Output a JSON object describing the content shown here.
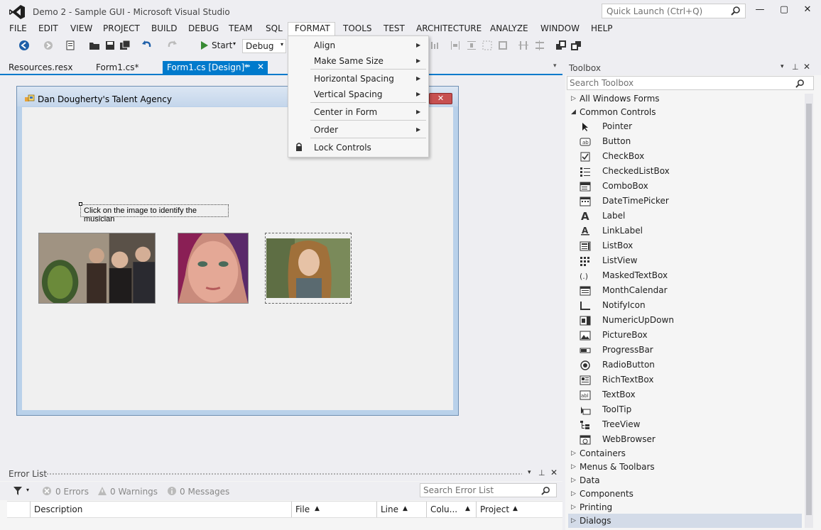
{
  "window": {
    "title": "Demo 2 - Sample GUI - Microsoft Visual Studio",
    "quick_launch_placeholder": "Quick Launch (Ctrl+Q)",
    "minimize": "—",
    "maximize": "▢",
    "close": "✕"
  },
  "menu": [
    "FILE",
    "EDIT",
    "VIEW",
    "PROJECT",
    "BUILD",
    "DEBUG",
    "TEAM",
    "SQL",
    "FORMAT",
    "TOOLS",
    "TEST",
    "ARCHITECTURE",
    "ANALYZE",
    "WINDOW",
    "HELP"
  ],
  "toolbar": {
    "start_label": "Start",
    "config_value": "Debug"
  },
  "tabs": {
    "resources": "Resources.resx",
    "form_cs": "Form1.cs*",
    "form_design": "Form1.cs [Design]*"
  },
  "format_menu": {
    "align": "Align",
    "make_same_size": "Make Same Size",
    "horizontal_spacing": "Horizontal Spacing",
    "vertical_spacing": "Vertical Spacing",
    "center_in_form": "Center in Form",
    "order": "Order",
    "lock_controls": "Lock Controls"
  },
  "form": {
    "title": "Dan Dougherty's Talent Agency",
    "close": "✕",
    "label_text": "Click on the image to identify the musician"
  },
  "error_list": {
    "title": "Error List",
    "errors": "0 Errors",
    "warnings": "0 Warnings",
    "messages": "0 Messages",
    "search_placeholder": "Search Error List",
    "columns": {
      "description": "Description",
      "file": "File",
      "line": "Line",
      "column": "Colu...",
      "project": "Project"
    }
  },
  "toolbox": {
    "title": "Toolbox",
    "search_placeholder": "Search Toolbox",
    "all_windows_forms": "All Windows Forms",
    "common_controls": "Common Controls",
    "items": [
      "Pointer",
      "Button",
      "CheckBox",
      "CheckedListBox",
      "ComboBox",
      "DateTimePicker",
      "Label",
      "LinkLabel",
      "ListBox",
      "ListView",
      "MaskedTextBox",
      "MonthCalendar",
      "NotifyIcon",
      "NumericUpDown",
      "PictureBox",
      "ProgressBar",
      "RadioButton",
      "RichTextBox",
      "TextBox",
      "ToolTip",
      "TreeView",
      "WebBrowser"
    ],
    "groups_after": [
      "Containers",
      "Menus & Toolbars",
      "Data",
      "Components",
      "Printing",
      "Dialogs"
    ]
  },
  "colors": {
    "accent": "#007acc",
    "form_title_bg": "#c4d6eb",
    "close_red": "#c75050"
  }
}
